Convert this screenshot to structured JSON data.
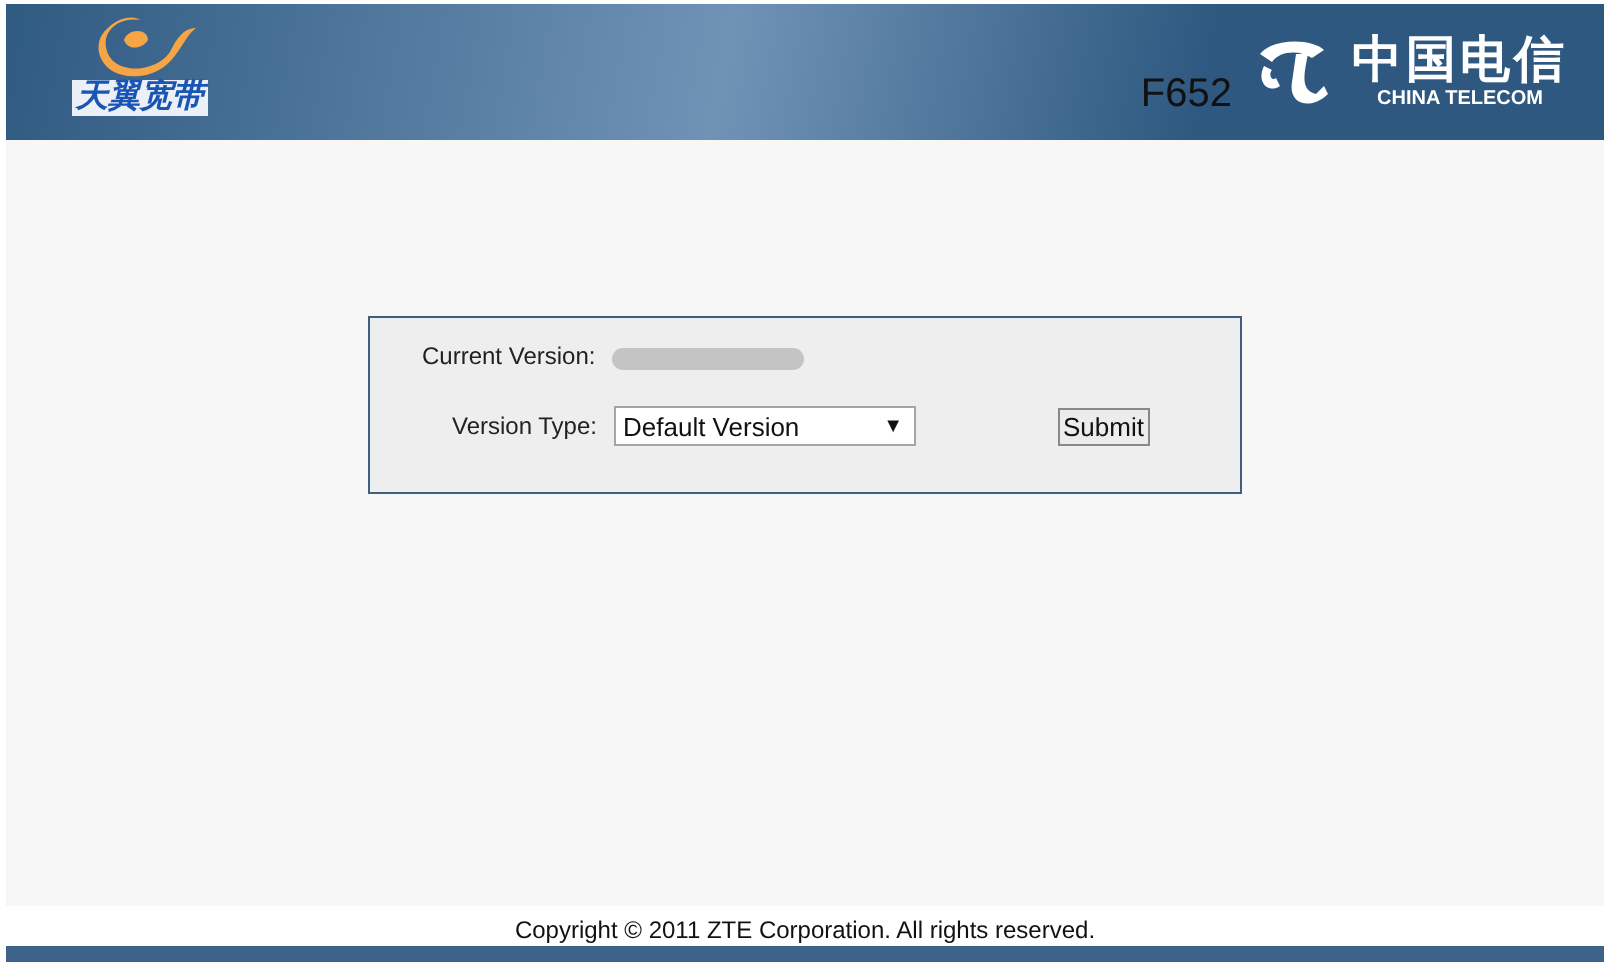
{
  "header": {
    "brand_left": "天翼宽带",
    "model": "F652",
    "brand_right": "中国电信",
    "brand_right_sub": "CHINA TELECOM"
  },
  "form": {
    "current_version_label": "Current Version:",
    "current_version_redacted": true,
    "version_type_label": "Version Type:",
    "version_type_value": "Default Version",
    "dropdown_arrow": "▼",
    "submit": "Submit"
  },
  "footer": {
    "copyright": "Copyright © 2011 ZTE Corporation. All rights reserved."
  }
}
